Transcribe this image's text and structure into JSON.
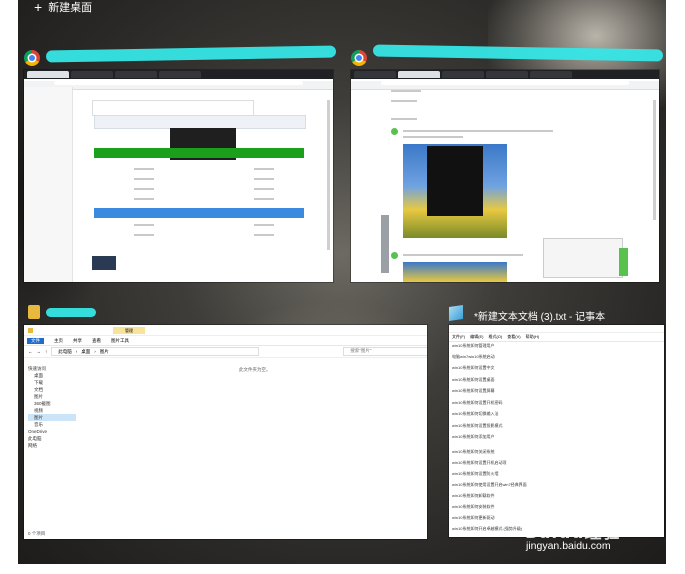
{
  "task_view": {
    "new_desktop_label": "新建桌面"
  },
  "windows": [
    {
      "id": "browser-1",
      "icon": "chrome-icon",
      "title_redacted": true
    },
    {
      "id": "browser-2",
      "icon": "chrome-icon",
      "title_redacted": true
    },
    {
      "id": "file-explorer",
      "icon": "folder-icon",
      "title_redacted": true,
      "ribbon_tabs": [
        "文件",
        "主页",
        "共享",
        "查看",
        "图片工具"
      ],
      "manage_tab": "管理",
      "breadcrumb": [
        "此电脑",
        "桌面",
        "图片"
      ],
      "search_placeholder": "搜索\"图片\"",
      "empty_message": "此文件夹为空。",
      "nav_items": [
        "快速访问",
        "桌面",
        "下载",
        "文档",
        "图片",
        "360截图",
        "视频",
        "图片",
        "音乐",
        "OneDrive",
        "此电脑",
        "网络"
      ],
      "status": "0 个项目"
    },
    {
      "id": "notepad",
      "icon": "notepad-icon",
      "title": "*新建文本文档 (3).txt - 记事本",
      "menu": [
        "文件(F)",
        "编辑(E)",
        "格式(O)",
        "查看(V)",
        "帮助(H)"
      ],
      "lines": [
        "win10系统如何管理用户",
        "电脑win7win10系统启动",
        "win10系统如何设置中文",
        "win10系统如何设置桌面",
        "win10系统如何设置屏幕",
        "win10系统如何设置开机密码",
        "win10系统如何切换输入法",
        "win10系统如何设置投影模式",
        "win10系统如何添加用户",
        "win10系统如何关闭系统",
        "win10系统如何设置开机启动项",
        "win10系统如何设置防火墙",
        "win10系统如何使用设置开启win7经典界面",
        "win10系统如何卸载软件",
        "win10系统如何安装软件",
        "win10系统如何更新驱动",
        "win10系统如何开启卓越模式 (强势升级)"
      ]
    }
  ],
  "watermark": {
    "brand": "Baidu经验",
    "url": "jingyan.baidu.com"
  },
  "colors": {
    "accent_green": "#1aa01a",
    "accent_blue": "#3c8ae0",
    "highlight_cyan": "#36e6e6"
  }
}
